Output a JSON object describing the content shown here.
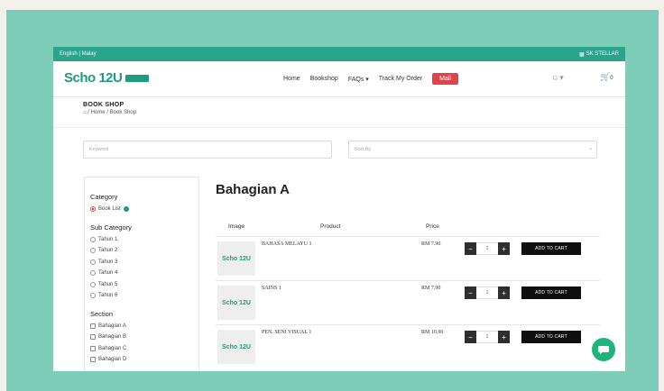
{
  "topbar": {
    "languages": "English | Malay",
    "school": "SK STELLAR"
  },
  "brand": {
    "name": "Scho 12U"
  },
  "nav": {
    "home": "Home",
    "bookshop": "Bookshop",
    "faqs": "FAQs ▾",
    "track": "Track My Order",
    "mall": "Mall",
    "cart_count": "0"
  },
  "page": {
    "title": "BOOK SHOP",
    "crumb_sep": "/",
    "crumb_home": "Home",
    "crumb_current": "Book Shop"
  },
  "search": {
    "placeholder": "Keyword"
  },
  "sort": {
    "placeholder": "Sort By"
  },
  "sidebar": {
    "category_title": "Category",
    "category_item": "Book List",
    "subcategory_title": "Sub Category",
    "subcategories": [
      "Tahun 1",
      "Tahun 2",
      "Tahun 3",
      "Tahun 4",
      "Tahun 5",
      "Tahun 6"
    ],
    "section_title": "Section",
    "sections": [
      "Bahagian A",
      "Bahagian B",
      "Bahagian C",
      "Bahagian D"
    ]
  },
  "main": {
    "section_title": "Bahagian A",
    "columns": {
      "image": "Image",
      "product": "Product",
      "price": "Price"
    },
    "products": [
      {
        "name": "BAHASA MELAYU 1",
        "price": "RM 7.90",
        "qty": "1",
        "add": "ADD TO CART",
        "thumb": "Scho 12U"
      },
      {
        "name": "SAINS 1",
        "price": "RM 7.90",
        "qty": "1",
        "add": "ADD TO CART",
        "thumb": "Scho 12U"
      },
      {
        "name": "PEN. SENI VISUAL 1",
        "price": "RM 10.90",
        "qty": "1",
        "add": "ADD TO CART",
        "thumb": "Scho 12U"
      }
    ]
  },
  "colors": {
    "accent": "#2aa58c",
    "mall": "#e0434a",
    "frame": "#7dcdb9",
    "chat": "#20b47d"
  }
}
